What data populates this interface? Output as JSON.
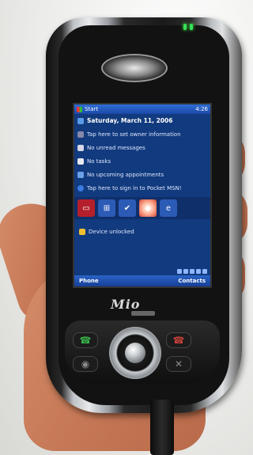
{
  "screen": {
    "start_label": "Start",
    "clock": "4:26",
    "today": {
      "date": "Saturday, March 11, 2006",
      "owner": "Tap here to set owner information",
      "messages": "No unread messages",
      "tasks": "No tasks",
      "appointments": "No upcoming appointments",
      "msn": "Tap here to sign in to Pocket MSN!"
    },
    "status": "Device unlocked",
    "softkeys": {
      "left": "Phone",
      "right": "Contacts"
    }
  },
  "device": {
    "logo": "Mio"
  },
  "colors": {
    "screen_bg": "#123a7e",
    "taskbar": "#2b63c6",
    "device_body": "#1a1a1a",
    "silver_trim": "#c8ccd0"
  }
}
